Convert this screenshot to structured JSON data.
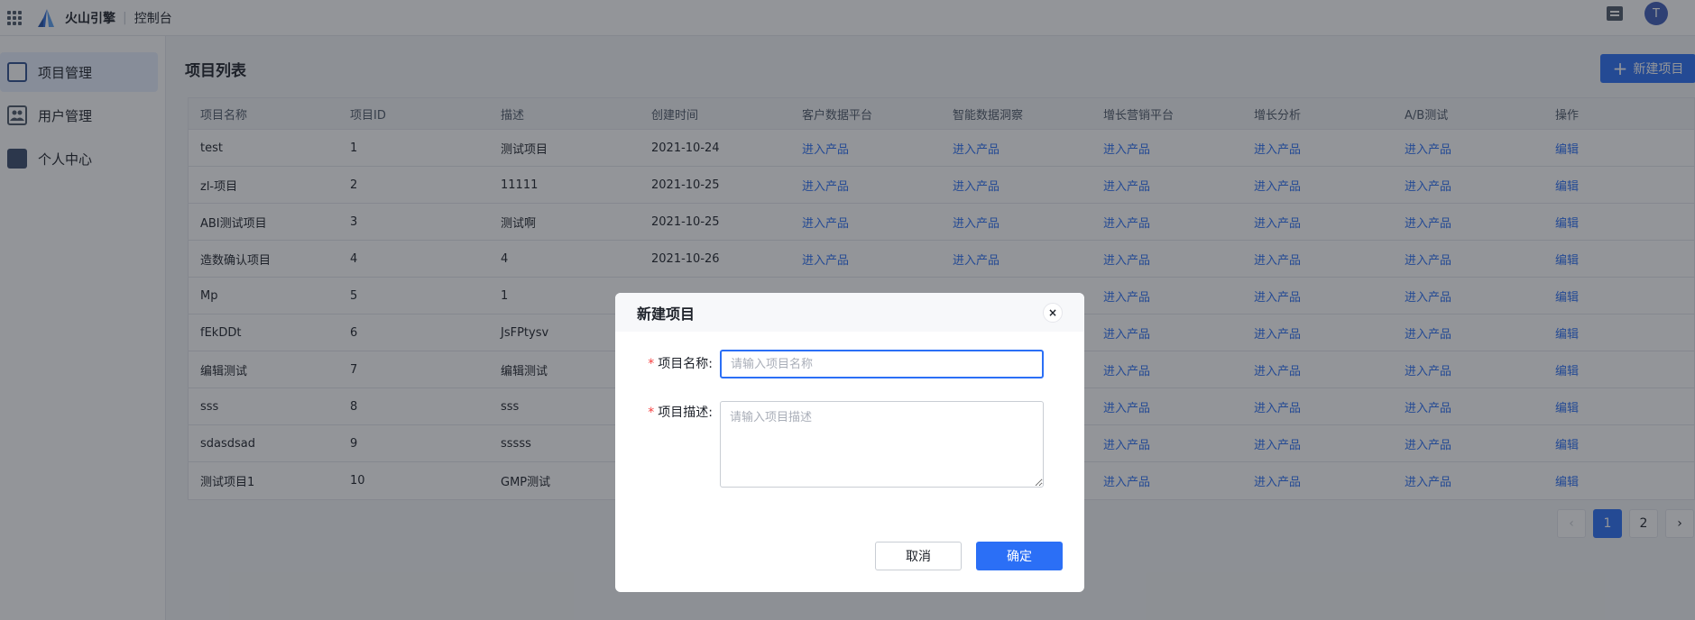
{
  "topbar": {
    "brand": "火山引擎",
    "console": "控制台",
    "avatar_letter": "T"
  },
  "sidebar": {
    "items": [
      {
        "label": "项目管理",
        "icon": "project-grid-icon"
      },
      {
        "label": "用户管理",
        "icon": "users-icon"
      },
      {
        "label": "个人中心",
        "icon": "user-center-icon"
      }
    ]
  },
  "main": {
    "title": "项目列表",
    "new_button": "新建项目",
    "table": {
      "headers": [
        "项目名称",
        "项目ID",
        "描述",
        "创建时间",
        "客户数据平台",
        "智能数据洞察",
        "增长营销平台",
        "增长分析",
        "A/B测试",
        "操作"
      ],
      "rows": [
        [
          "test",
          "1",
          "测试项目",
          "2021-10-24",
          "进入产品",
          "进入产品",
          "进入产品",
          "进入产品",
          "进入产品",
          "编辑"
        ],
        [
          "zl-项目",
          "2",
          "11111",
          "2021-10-25",
          "进入产品",
          "进入产品",
          "进入产品",
          "进入产品",
          "进入产品",
          "编辑"
        ],
        [
          "ABI测试项目",
          "3",
          "测试啊",
          "2021-10-25",
          "进入产品",
          "进入产品",
          "进入产品",
          "进入产品",
          "进入产品",
          "编辑"
        ],
        [
          "造数确认项目",
          "4",
          "4",
          "2021-10-26",
          "进入产品",
          "进入产品",
          "进入产品",
          "进入产品",
          "进入产品",
          "编辑"
        ],
        [
          "Mp",
          "5",
          "1",
          "",
          "",
          "",
          "进入产品",
          "进入产品",
          "进入产品",
          "编辑"
        ],
        [
          "fEkDDt",
          "6",
          "JsFPtysv",
          "",
          "",
          "",
          "进入产品",
          "进入产品",
          "进入产品",
          "编辑"
        ],
        [
          "编辑测试",
          "7",
          "编辑测试",
          "",
          "",
          "",
          "进入产品",
          "进入产品",
          "进入产品",
          "编辑"
        ],
        [
          "sss",
          "8",
          "sss",
          "",
          "",
          "",
          "进入产品",
          "进入产品",
          "进入产品",
          "编辑"
        ],
        [
          "sdasdsad",
          "9",
          "sssss",
          "",
          "",
          "",
          "进入产品",
          "进入产品",
          "进入产品",
          "编辑"
        ],
        [
          "测试项目1",
          "10",
          "GMP测试",
          "",
          "",
          "",
          "进入产品",
          "进入产品",
          "进入产品",
          "编辑"
        ]
      ]
    },
    "pagination": {
      "prev": "‹",
      "pages": [
        "1",
        "2"
      ],
      "current": "1",
      "next": "›"
    }
  },
  "modal": {
    "title": "新建项目",
    "close": "×",
    "name_label": "项目名称:",
    "name_placeholder": "请输入项目名称",
    "name_value": "",
    "desc_label": "项目描述:",
    "desc_placeholder": "请输入项目描述",
    "required_mark": "*",
    "cancel": "取消",
    "confirm": "确定"
  },
  "colors": {
    "primary": "#2b6ff6",
    "required": "#f53f3f"
  }
}
